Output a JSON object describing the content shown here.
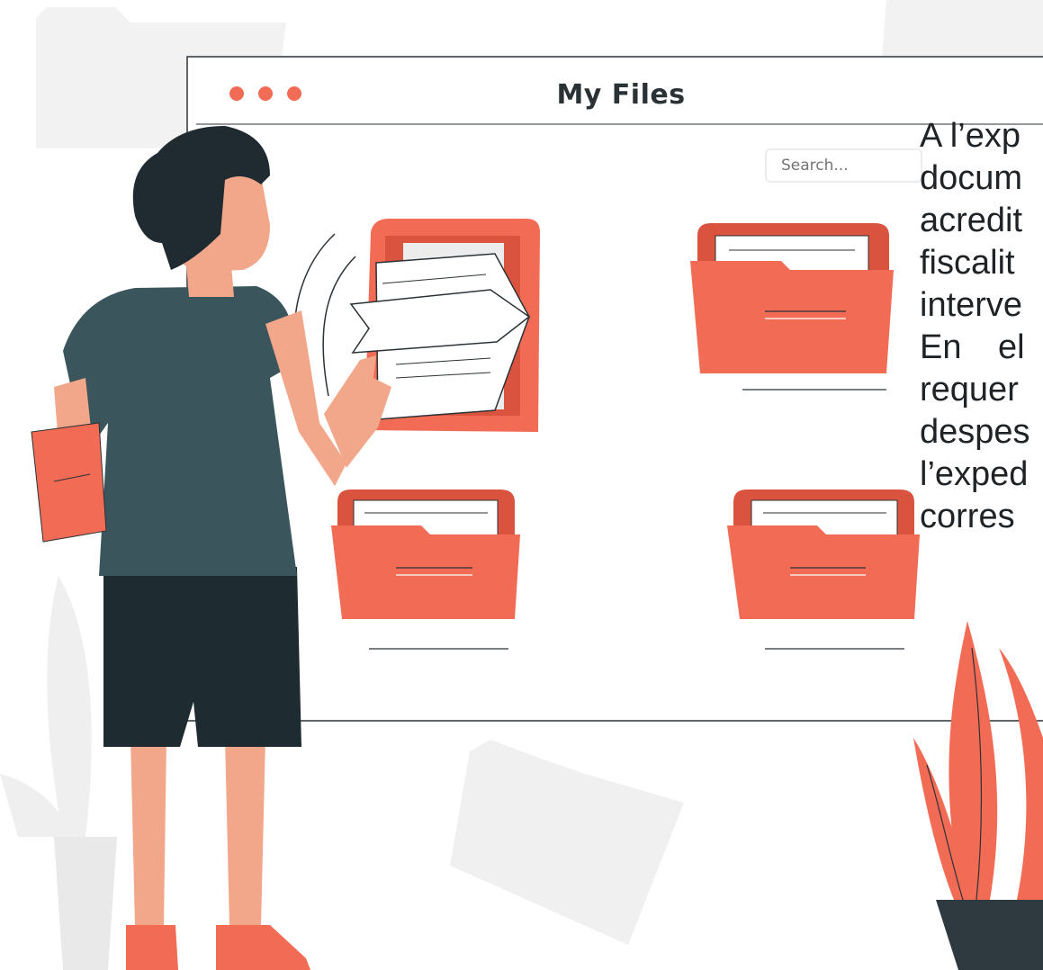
{
  "window": {
    "title": "My  Files",
    "search_placeholder": "Search..."
  },
  "text_block": {
    "lines": [
      "A l’exp",
      "docum",
      "acredit",
      "fiscalit",
      "interve",
      "En el",
      "requer",
      "despes",
      "l’exped",
      "corres"
    ]
  },
  "colors": {
    "accent": "#f26b55",
    "accent_dark": "#d9533f",
    "shirt": "#3a565c",
    "shorts": "#1e2c31",
    "hair": "#1f2b30",
    "skin": "#f2a78a",
    "background_shapes": "#f2f2f2"
  }
}
